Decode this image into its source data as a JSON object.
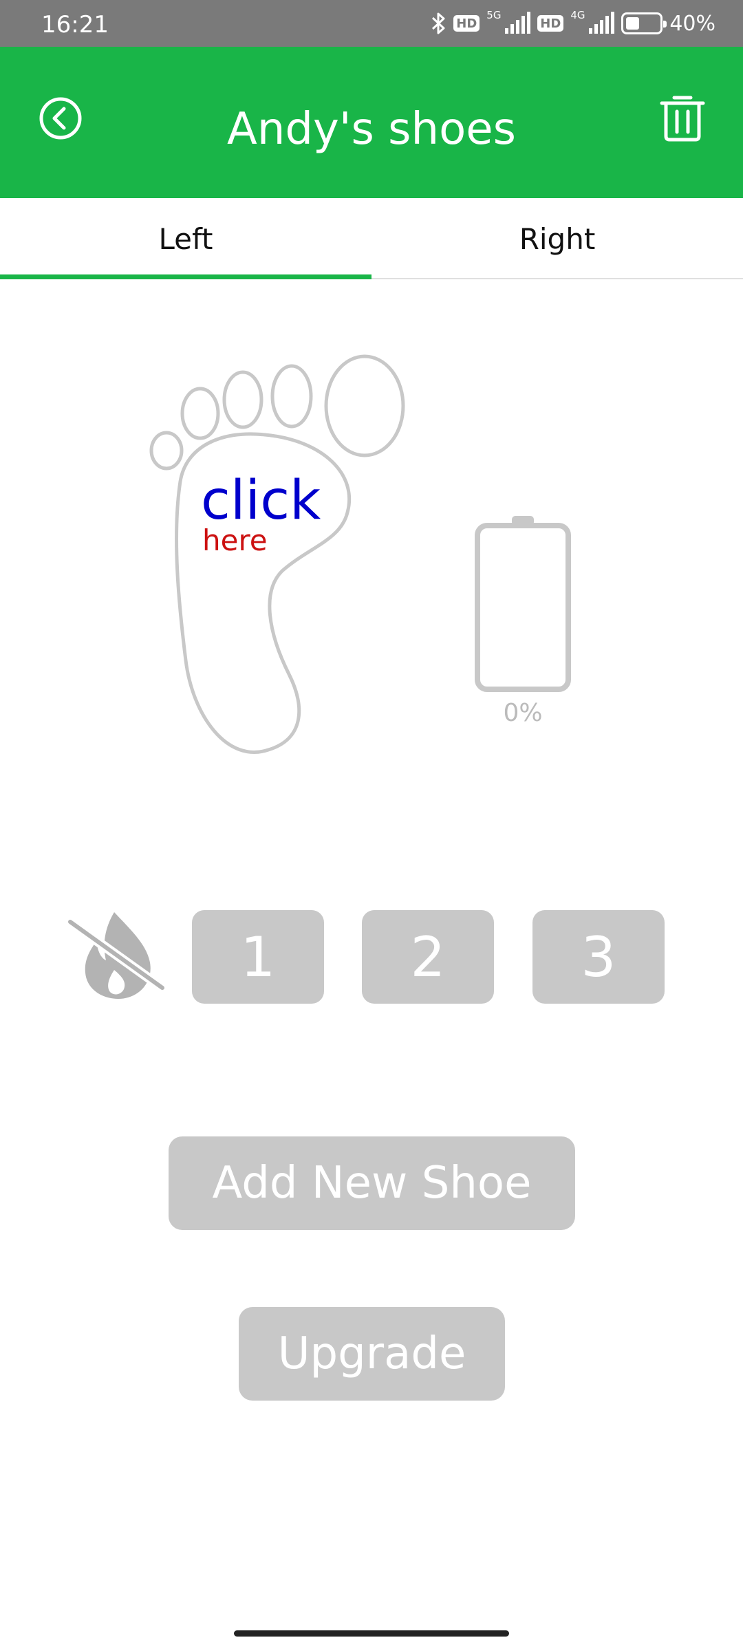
{
  "status_bar": {
    "time": "16:21",
    "hd_badge_1": "HD",
    "net_1": "5G",
    "hd_badge_2": "HD",
    "net_2": "4G",
    "battery_level": 0.4,
    "battery_text": "40%"
  },
  "header": {
    "title": "Andy's shoes",
    "back_icon": "back-circle-chevron-icon",
    "delete_icon": "trash-icon",
    "bar_color": "#19b548"
  },
  "tabs": [
    {
      "label": "Left",
      "selected": true
    },
    {
      "label": "Right",
      "selected": false
    }
  ],
  "foot": {
    "click_text": "click",
    "here_text": "here",
    "click_color": "#0000cc",
    "here_color": "#cc1111"
  },
  "battery": {
    "level": 0,
    "text": "0%"
  },
  "heat": {
    "off_icon": "flame-off-icon",
    "levels": [
      "1",
      "2",
      "3"
    ]
  },
  "actions": {
    "add_shoe": "Add New Shoe",
    "upgrade": "Upgrade"
  },
  "colors": {
    "accent": "#19b548",
    "disabled": "#c8c8c8",
    "outline": "#c8c8c8"
  }
}
